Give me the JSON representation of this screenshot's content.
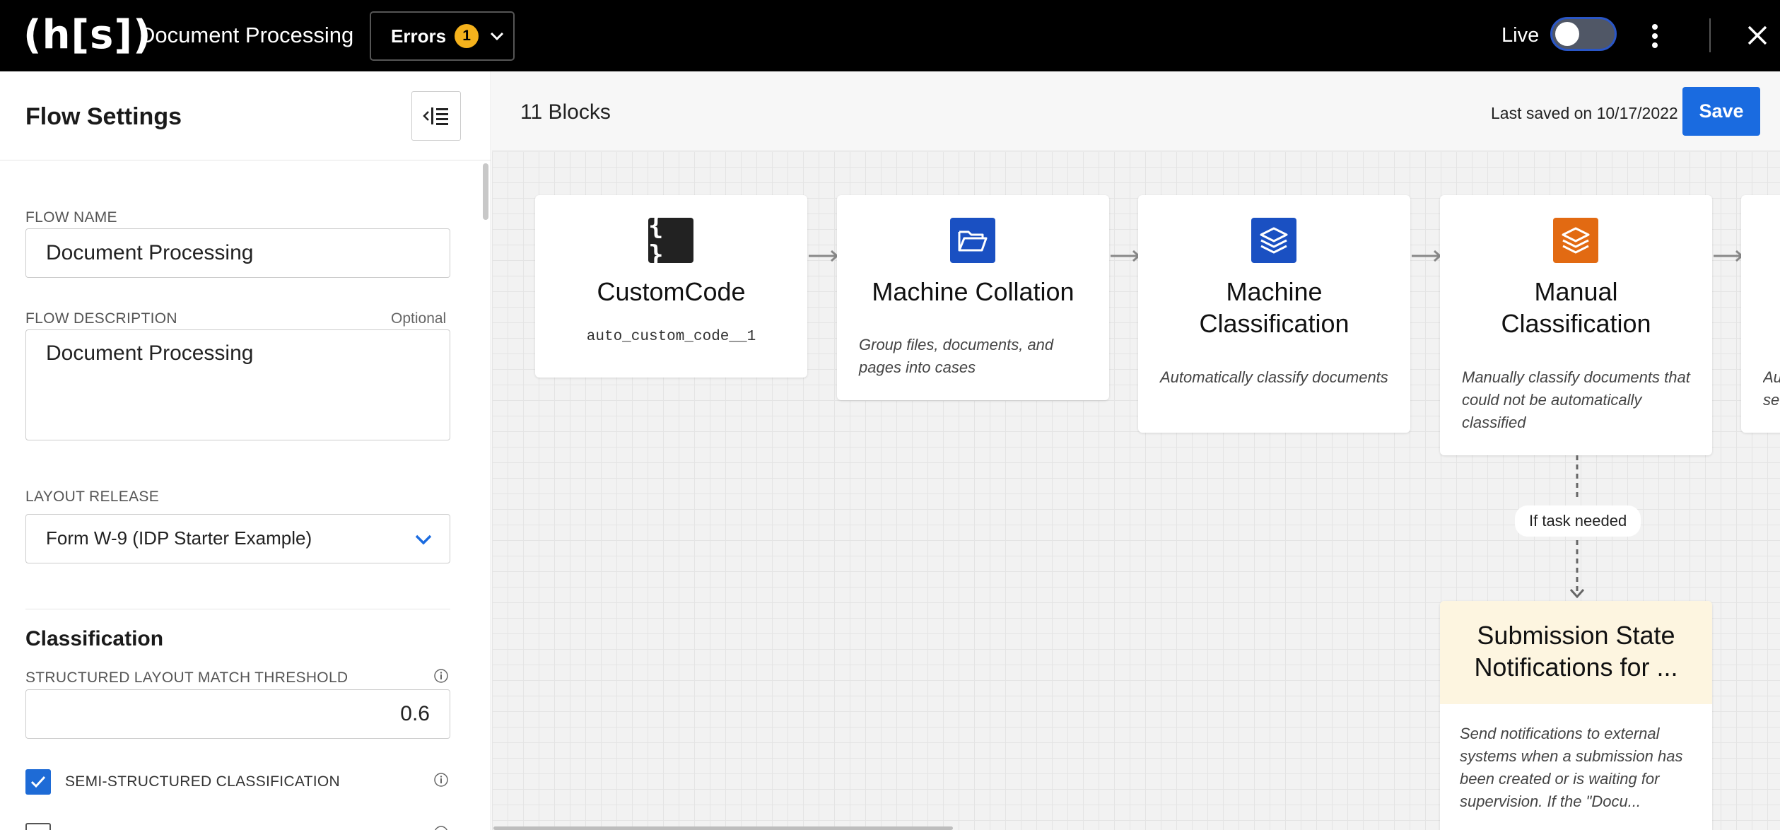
{
  "topbar": {
    "logo": "(h[s])",
    "title": "Document Processing",
    "errors_label": "Errors",
    "errors_count": "1",
    "live_label": "Live",
    "live_on": false
  },
  "sidebar": {
    "title": "Flow Settings",
    "flow_name_label": "FLOW NAME",
    "flow_name_value": "Document Processing",
    "flow_desc_label": "FLOW DESCRIPTION",
    "flow_desc_optional": "Optional",
    "flow_desc_value": "Document Processing",
    "layout_release_label": "LAYOUT RELEASE",
    "layout_release_value": "Form W-9 (IDP Starter Example)",
    "classification_title": "Classification",
    "threshold_label": "STRUCTURED LAYOUT MATCH THRESHOLD",
    "threshold_value": "0.6",
    "semi_structured_label": "SEMI-STRUCTURED CLASSIFICATION",
    "semi_structured_checked": true
  },
  "canvas": {
    "blocks_count": "11 Blocks",
    "last_saved": "Last saved on 10/17/2022",
    "save_label": "Save",
    "blocks": [
      {
        "title": "CustomCode",
        "code": "auto_custom_code__1",
        "icon": "curly-braces-icon",
        "color": "#222222"
      },
      {
        "title": "Machine Collation",
        "desc": "Group files, documents, and pages into cases",
        "icon": "folder-open-icon",
        "color": "#1a50c2"
      },
      {
        "title": "Machine Classification",
        "desc": "Automatically classify documents",
        "icon": "layers-icon",
        "color": "#1a50c2"
      },
      {
        "title": "Manual Classification",
        "desc": "Manually classify documents that could not be automatically classified",
        "icon": "layers-icon",
        "color": "#e26a12"
      },
      {
        "desc_partial": "Au se"
      }
    ],
    "branch_label": "If task needed",
    "notification_block": {
      "title": "Submission State Notifications for ...",
      "desc": "Send notifications to external systems when a submission has been created or is waiting for supervision. If the \"Docu..."
    }
  }
}
